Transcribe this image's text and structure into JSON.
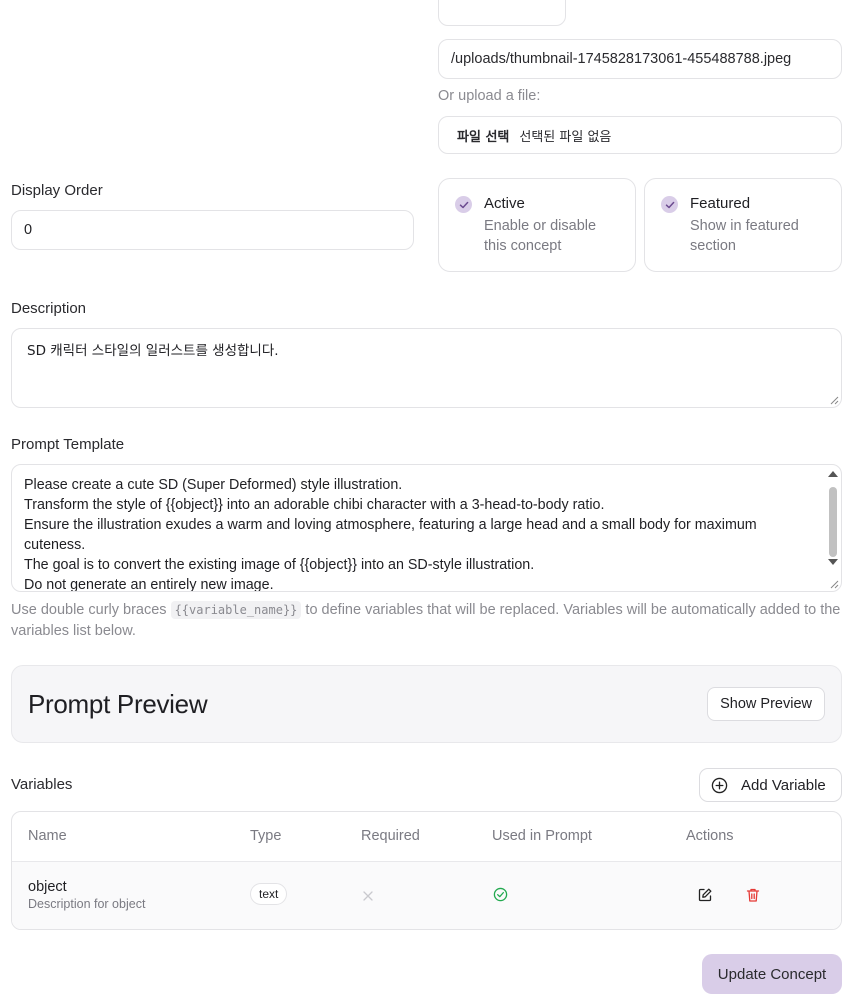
{
  "thumbnail": {
    "url_value": "/uploads/thumbnail-1745828173061-455488788.jpeg",
    "upload_label": "Or upload a file:",
    "file_button": "파일 선택",
    "file_status": "선택된 파일 없음"
  },
  "display_order": {
    "label": "Display Order",
    "value": "0"
  },
  "toggles": {
    "active": {
      "title": "Active",
      "description": "Enable or disable this concept",
      "checked": true
    },
    "featured": {
      "title": "Featured",
      "description": "Show in featured section",
      "checked": true
    }
  },
  "description": {
    "label": "Description",
    "value": "SD 캐릭터 스타일의 일러스트를 생성합니다."
  },
  "prompt_template": {
    "label": "Prompt Template",
    "lines": [
      "Please create a cute SD (Super Deformed) style illustration.",
      "Transform the style of {{object}} into an adorable chibi character with a 3-head-to-body ratio.",
      "Ensure the illustration exudes a warm and loving atmosphere, featuring a large head and a small body for maximum",
      "cuteness.",
      "The goal is to convert the existing image of {{object}} into an SD-style illustration.",
      "Do not generate an entirely new image."
    ],
    "help_prefix": "Use double curly braces ",
    "help_code": "{{variable_name}}",
    "help_suffix": " to define variables that will be replaced. Variables will be automatically added to the variables list below."
  },
  "prompt_preview": {
    "title": "Prompt Preview",
    "button": "Show Preview"
  },
  "variables": {
    "label": "Variables",
    "add_button": "Add Variable",
    "columns": [
      "Name",
      "Type",
      "Required",
      "Used in Prompt",
      "Actions"
    ],
    "rows": [
      {
        "name": "object",
        "description": "Description for object",
        "type": "text",
        "required": false,
        "used_in_prompt": true
      }
    ]
  },
  "submit": {
    "label": "Update Concept"
  },
  "colors": {
    "accent": "#d9cde8",
    "accent_check": "#6b4a8f",
    "success": "#22a94f",
    "danger": "#e53935",
    "muted": "#8a8a90"
  }
}
